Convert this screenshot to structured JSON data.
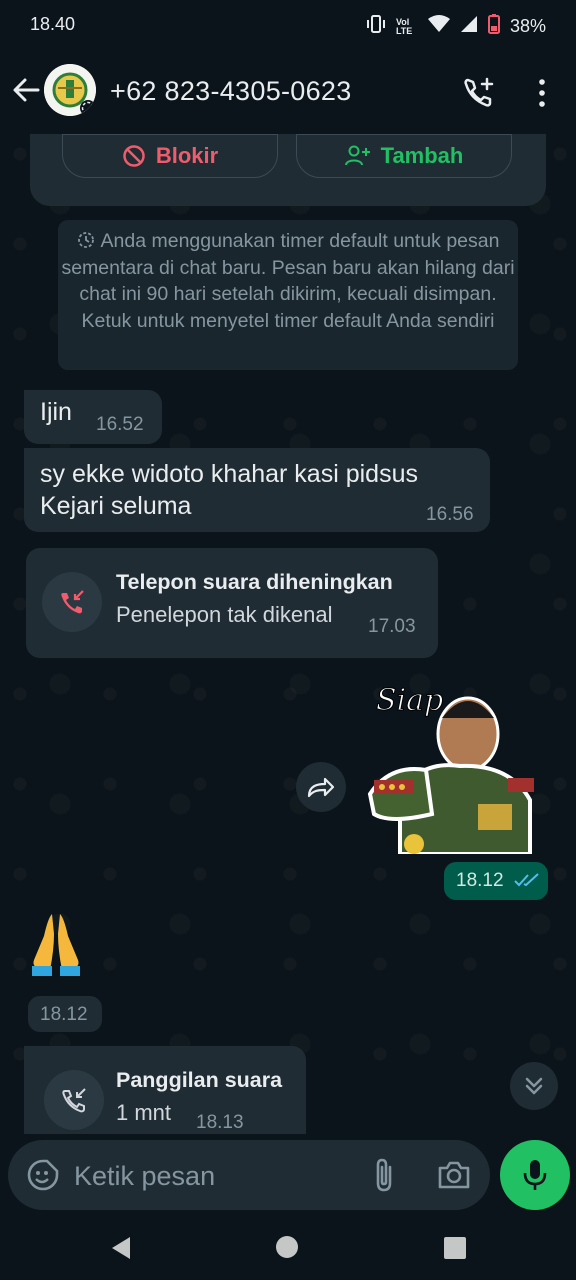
{
  "status_bar": {
    "time": "18.40",
    "network_label": "Vol LTE",
    "battery": "38%"
  },
  "header": {
    "contact_name": "+62 823-4305-0623",
    "icons": [
      "back-arrow-icon",
      "avatar",
      "add-call-icon",
      "more-vert-icon"
    ]
  },
  "actions": {
    "block_label": "Blokir",
    "add_label": "Tambah"
  },
  "system_note": "Anda menggunakan timer default untuk pesan sementara di chat baru. Pesan baru akan hilang dari chat ini 90 hari setelah dikirim, kecuali disimpan. Ketuk untuk menyetel timer default Anda sendiri",
  "messages": [
    {
      "direction": "in",
      "text": "Ijin",
      "time": "16.52"
    },
    {
      "direction": "in",
      "text": "sy ekke widoto khahar kasi pidsus Kejari seluma",
      "time": "16.56"
    },
    {
      "direction": "in",
      "type": "call",
      "title": "Telepon suara diheningkan",
      "subtitle": "Penelepon tak dikenal",
      "time": "17.03"
    },
    {
      "direction": "out",
      "type": "sticker",
      "sticker_text": "Siap",
      "time": "18.12",
      "read": true
    },
    {
      "direction": "in",
      "type": "emoji",
      "emoji": "folded-hands",
      "time": "18.12"
    },
    {
      "direction": "in",
      "type": "call",
      "title": "Panggilan suara",
      "subtitle": "1 mnt",
      "time": "18.13"
    }
  ],
  "composer": {
    "placeholder": "Ketik pesan"
  },
  "colors": {
    "background": "#0b141a",
    "incoming_bubble": "#202c33",
    "outgoing_bubble": "#005c4b",
    "accent_green": "#21c063",
    "block_red": "#f15c6d",
    "read_ticks": "#53bdeb"
  }
}
